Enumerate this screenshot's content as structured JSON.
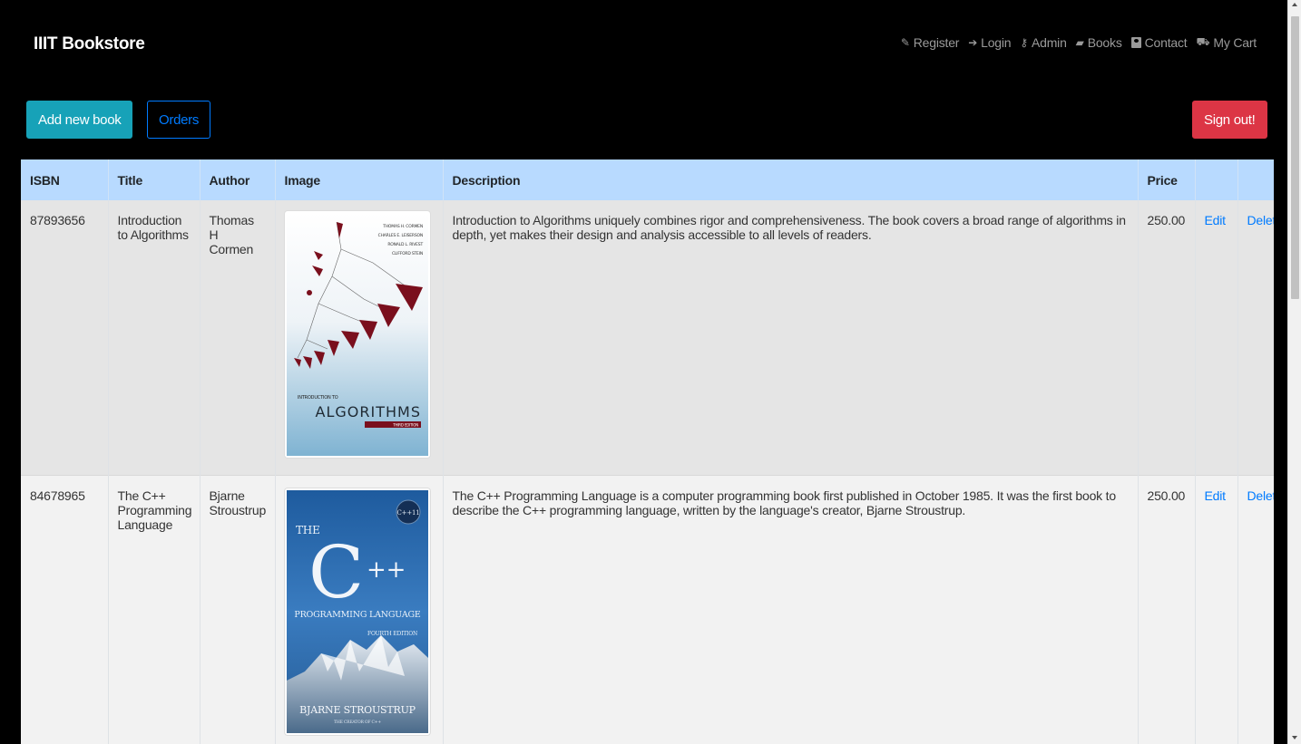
{
  "navbar": {
    "brand": "IIIT Bookstore",
    "links": [
      {
        "label": "Register",
        "icon": "pencil-icon"
      },
      {
        "label": "Login",
        "icon": "login-icon"
      },
      {
        "label": "Admin",
        "icon": "key-icon"
      },
      {
        "label": "Books",
        "icon": "book-icon"
      },
      {
        "label": "Contact",
        "icon": "contact-card-icon"
      },
      {
        "label": "My Cart",
        "icon": "cart-icon"
      }
    ]
  },
  "toolbar": {
    "add_label": "Add new book",
    "orders_label": "Orders",
    "signout_label": "Sign out!"
  },
  "table": {
    "headers": [
      "ISBN",
      "Title",
      "Author",
      "Image",
      "Description",
      "Price",
      "",
      ""
    ],
    "rows": [
      {
        "isbn": "87893656",
        "title": "Introduction to Algorithms",
        "author": "Thomas H Cormen",
        "description": "Introduction to Algorithms uniquely combines rigor and comprehensiveness. The book covers a broad range of algorithms in depth, yet makes their design and analysis accessible to all levels of readers.",
        "price": "250.00",
        "edit": "Edit",
        "delete": "Delete",
        "cover": {
          "authors": [
            "THOMAS H. CORMEN",
            "CHARLES E. LEISERSON",
            "RONALD L. RIVEST",
            "CLIFFORD STEIN"
          ],
          "subtitle": "INTRODUCTION TO",
          "title": "ALGORITHMS",
          "edition": "THIRD EDITION"
        }
      },
      {
        "isbn": "84678965",
        "title": "The C++ Programming Language",
        "author": "Bjarne Stroustrup",
        "description": "The C++ Programming Language is a computer programming book first published in October 1985. It was the first book to describe the C++ programming language, written by the language's creator, Bjarne Stroustrup.",
        "price": "250.00",
        "edit": "Edit",
        "delete": "Delete",
        "cover": {
          "the": "THE",
          "title_c": "C",
          "title_pp": "++",
          "badge": "C++11",
          "subtitle": "PROGRAMMING LANGUAGE",
          "edition": "FOURTH EDITION",
          "author": "BJARNE STROUSTRUP",
          "tagline": "THE CREATOR OF C++"
        }
      }
    ]
  },
  "colors": {
    "navbar_bg": "#000000",
    "header_bg": "#b8daff",
    "info": "#17a2b8",
    "primary": "#007bff",
    "danger": "#dc3545"
  }
}
